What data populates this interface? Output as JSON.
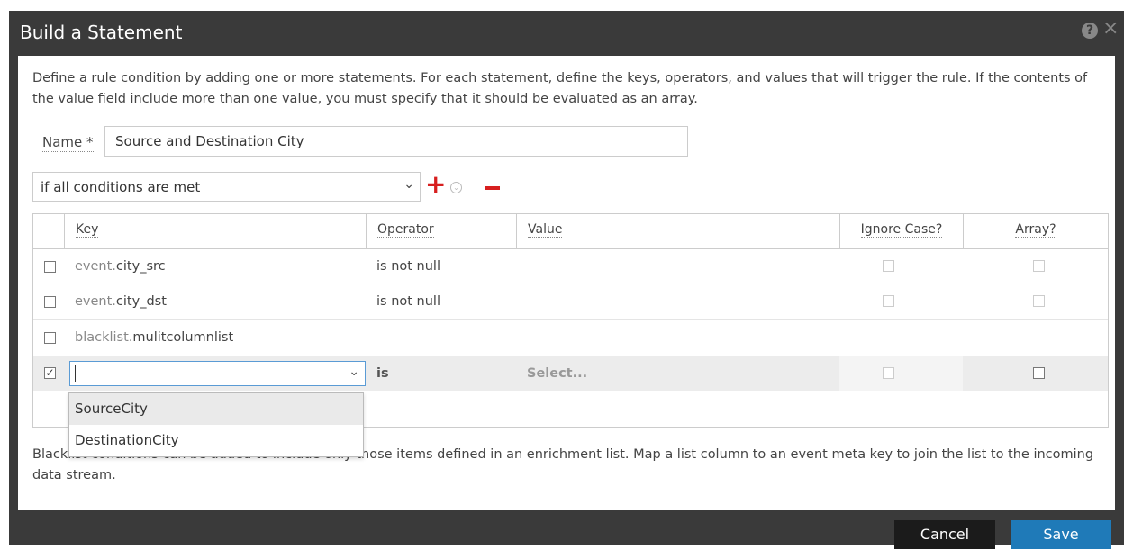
{
  "dialog": {
    "title": "Build a Statement",
    "description": "Define a rule condition by adding one or more statements. For each statement, define the keys, operators, and values that will trigger the rule. If the contents of the value field include more than one value, you must specify that it should be evaluated as an array.",
    "name_label": "Name *",
    "name_value": "Source and Destination City",
    "condition_select": "if all conditions are met",
    "note": "Blacklist conditions can be added to include only those items defined in an enrichment list. Map a list column to an event meta key to join the list to the incoming data stream.",
    "cancel_label": "Cancel",
    "save_label": "Save"
  },
  "table": {
    "headers": {
      "key": "Key",
      "operator": "Operator",
      "value": "Value",
      "ignore_case": "Ignore Case?",
      "array": "Array?"
    },
    "rows": [
      {
        "prefix": "event.",
        "key": "city_src",
        "operator": "is not null",
        "checked": false
      },
      {
        "prefix": "event.",
        "key": "city_dst",
        "operator": "is not null",
        "checked": false
      },
      {
        "prefix": "blacklist.",
        "key": "mulitcolumnlist",
        "operator": "",
        "checked": false
      }
    ],
    "active_row": {
      "operator": "is",
      "value_placeholder": "Select...",
      "checked": true
    }
  },
  "dropdown": {
    "options": [
      "SourceCity",
      "DestinationCity"
    ]
  },
  "colors": {
    "accent": "#1f7ab8",
    "danger": "#d71f1f",
    "titlebar": "#3a3a3a"
  }
}
